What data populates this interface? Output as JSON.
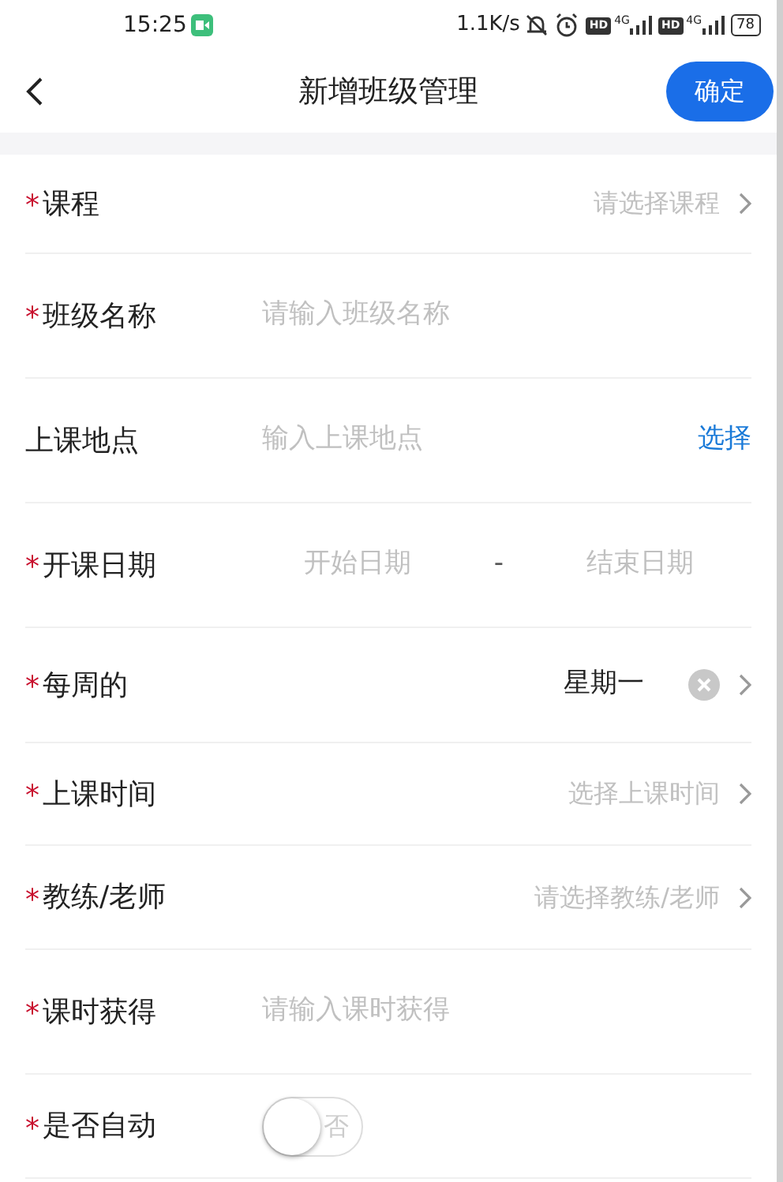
{
  "status_bar": {
    "time": "15:25",
    "speed": "1.1K/s",
    "badges": [
      "HD",
      "HD"
    ],
    "network": [
      "4G",
      "4G"
    ],
    "battery": "78"
  },
  "required_mark": "*",
  "header": {
    "title": "新增班级管理",
    "confirm": "确定"
  },
  "form": [
    {
      "kind": "select",
      "label": "课程",
      "required": true,
      "placeholder": "请选择课程"
    },
    {
      "kind": "input",
      "label": "班级名称",
      "required": true,
      "placeholder": "请输入班级名称"
    },
    {
      "kind": "location",
      "label": "上课地点",
      "required": false,
      "placeholder": "输入上课地点",
      "action": "选择"
    },
    {
      "kind": "daterange",
      "label": "开课日期",
      "required": true,
      "start_placeholder": "开始日期",
      "separator": "-",
      "end_placeholder": "结束日期"
    },
    {
      "kind": "weekday",
      "label": "每周的",
      "required": true,
      "value": "星期一"
    },
    {
      "kind": "select",
      "label": "上课时间",
      "required": true,
      "placeholder": "选择上课时间"
    },
    {
      "kind": "select",
      "label": "教练/老师",
      "required": true,
      "placeholder": "请选择教练/老师"
    },
    {
      "kind": "input",
      "label": "课时获得",
      "required": true,
      "placeholder": "请输入课时获得"
    },
    {
      "kind": "switch",
      "label": "是否自动",
      "required": true,
      "on": false,
      "switch_text": "否"
    }
  ]
}
